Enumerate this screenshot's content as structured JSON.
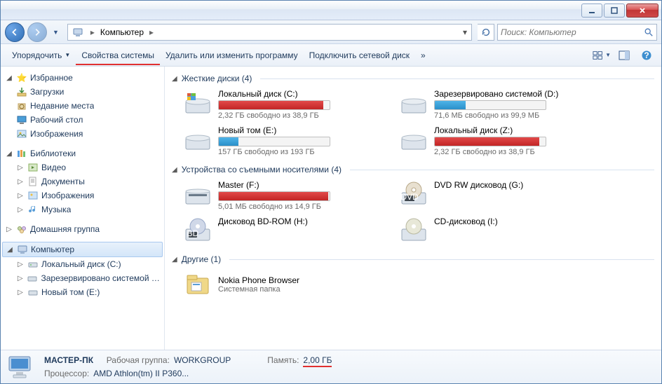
{
  "breadcrumb": {
    "root": "Компьютер"
  },
  "search": {
    "placeholder": "Поиск: Компьютер"
  },
  "toolbar": {
    "organize": "Упорядочить",
    "system_props": "Свойства системы",
    "uninstall": "Удалить или изменить программу",
    "map_drive": "Подключить сетевой диск",
    "more": "»"
  },
  "sidebar": {
    "favorites": {
      "label": "Избранное",
      "items": [
        "Загрузки",
        "Недавние места",
        "Рабочий стол",
        "Изображения"
      ]
    },
    "libraries": {
      "label": "Библиотеки",
      "items": [
        "Видео",
        "Документы",
        "Изображения",
        "Музыка"
      ]
    },
    "homegroup": "Домашняя группа",
    "computer": {
      "label": "Компьютер",
      "items": [
        "Локальный диск (C:)",
        "Зарезервировано системой (D:)",
        "Новый том (E:)"
      ]
    }
  },
  "categories": {
    "hdd": {
      "title": "Жесткие диски (4)",
      "drives": [
        {
          "name": "Локальный диск (C:)",
          "free": "2,32 ГБ свободно из 38,9 ГБ",
          "pct": 94,
          "warn": true,
          "icon": "hdd-win"
        },
        {
          "name": "Зарезервировано системой (D:)",
          "free": "71,6 МБ свободно из 99,9 МБ",
          "pct": 28,
          "warn": false,
          "icon": "hdd"
        },
        {
          "name": "Новый том (E:)",
          "free": "157 ГБ свободно из 193 ГБ",
          "pct": 18,
          "warn": false,
          "icon": "hdd"
        },
        {
          "name": "Локальный диск (Z:)",
          "free": "2,32 ГБ свободно из 38,9 ГБ",
          "pct": 94,
          "warn": true,
          "icon": "hdd"
        }
      ]
    },
    "removable": {
      "title": "Устройства со съемными носителями (4)",
      "drives": [
        {
          "name": "Master (F:)",
          "free": "5,01 МБ свободно из 14,9 ГБ",
          "pct": 99,
          "warn": true,
          "icon": "removable",
          "bar": true
        },
        {
          "name": "DVD RW дисковод (G:)",
          "icon": "dvd",
          "bar": false
        },
        {
          "name": "Дисковод BD-ROM (H:)",
          "icon": "bd",
          "bar": false
        },
        {
          "name": "CD-дисковод (I:)",
          "icon": "cd",
          "bar": false
        }
      ]
    },
    "other": {
      "title": "Другие (1)",
      "items": [
        {
          "name": "Nokia Phone Browser",
          "sub": "Системная папка",
          "icon": "folder"
        }
      ]
    }
  },
  "status": {
    "pc_name": "МАСТЕР-ПК",
    "workgroup_label": "Рабочая группа:",
    "workgroup": "WORKGROUP",
    "mem_label": "Память:",
    "mem": "2,00 ГБ",
    "cpu_label": "Процессор:",
    "cpu": "AMD Athlon(tm) II P360..."
  }
}
